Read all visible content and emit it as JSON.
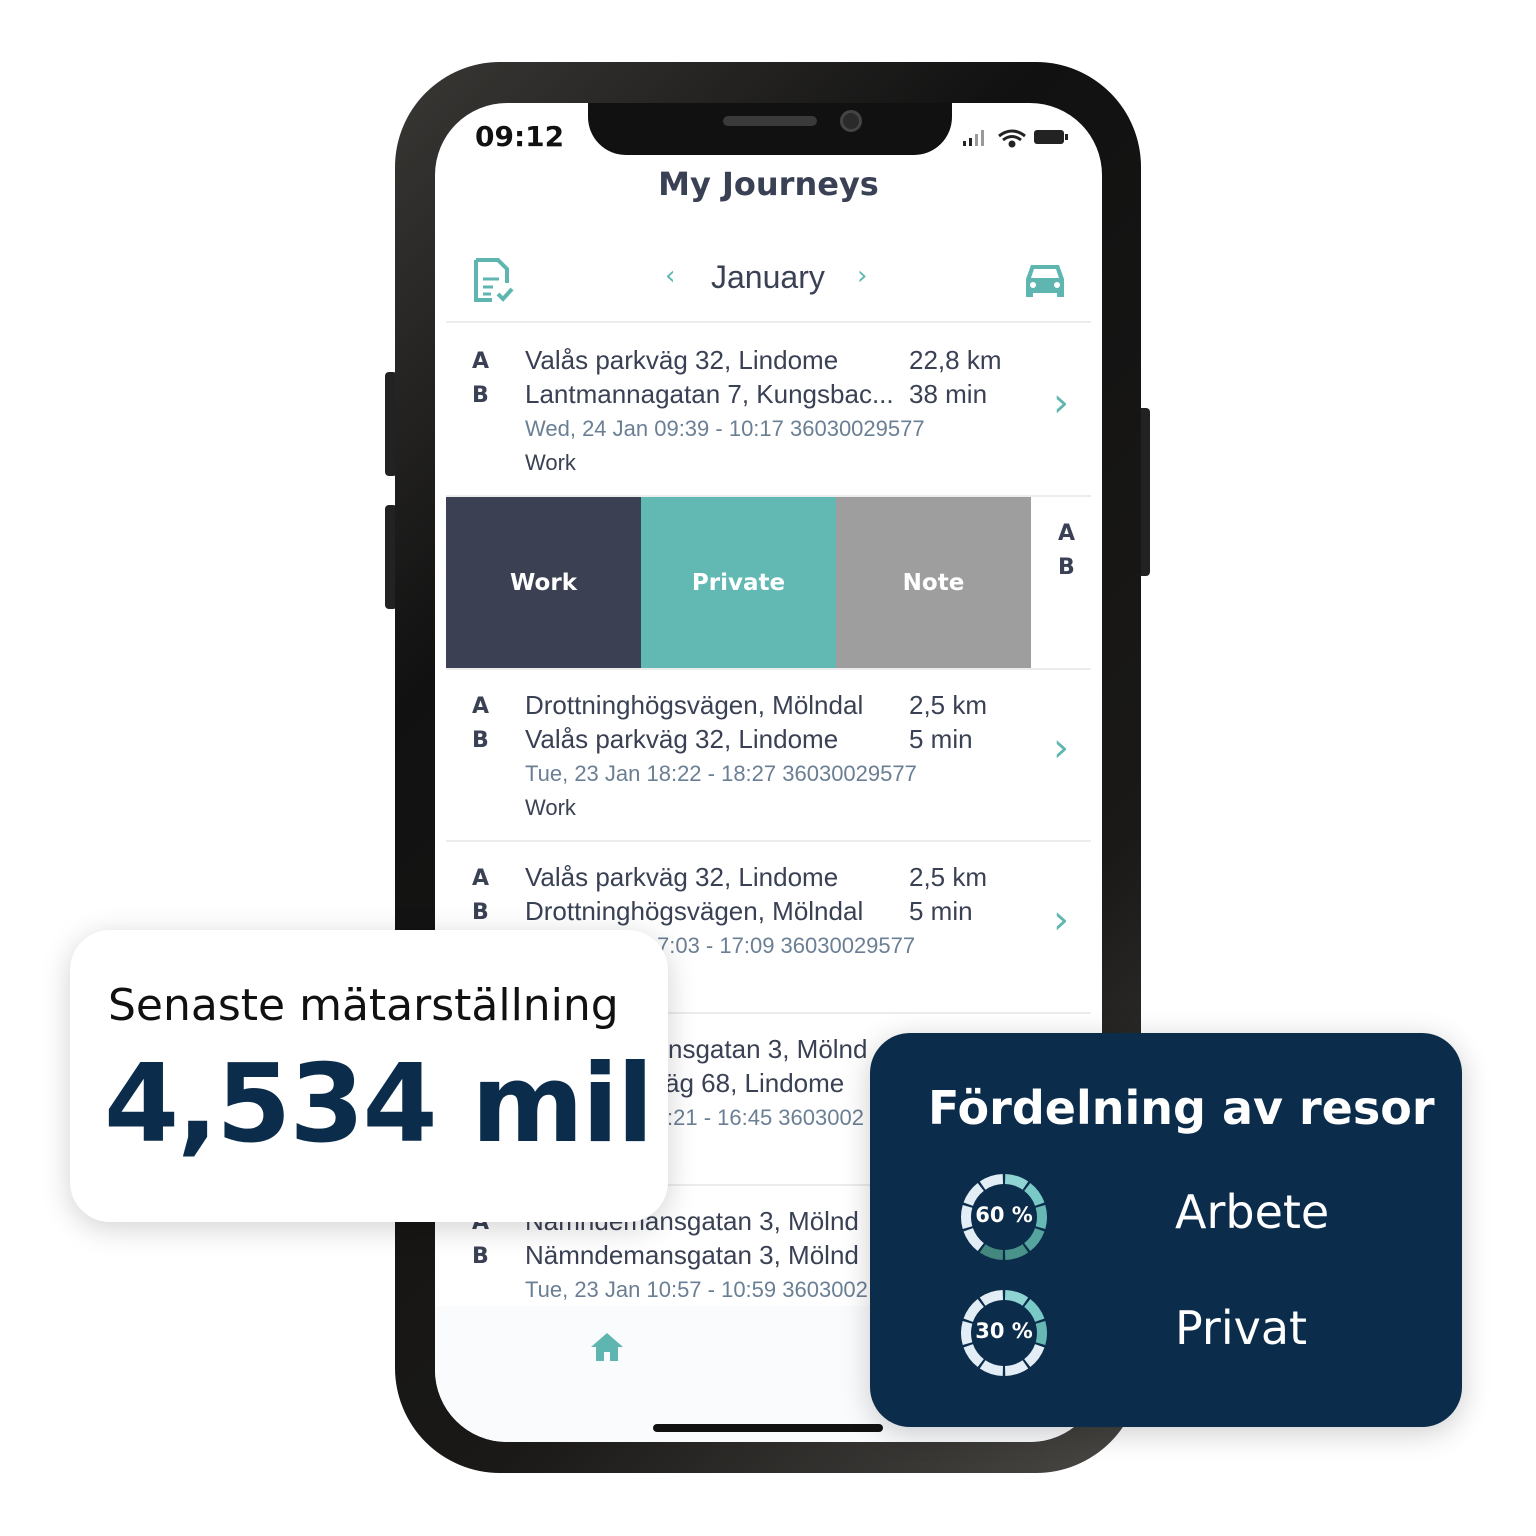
{
  "status_bar": {
    "time": "09:12"
  },
  "header": {
    "title": "My Journeys",
    "month": "January"
  },
  "journeys": [
    {
      "a_label": "A",
      "b_label": "B",
      "from": "Valås parkväg 32, Lindome",
      "to": "Lantmannagatan 7, Kungsbac...",
      "distance": "22,8 km",
      "duration": "38 min",
      "meta": "Wed, 24 Jan 09:39 - 10:17  36030029577",
      "category": "Work"
    },
    {
      "a_label": "A",
      "b_label": "B",
      "from": "Drottninghögsvägen, Mölndal",
      "to": "Valås parkväg 32, Lindome",
      "distance": "2,5 km",
      "duration": "5 min",
      "meta": "Tue, 23 Jan 18:22 - 18:27  36030029577",
      "category": "Work"
    },
    {
      "a_label": "A",
      "b_label": "B",
      "from": "Valås parkväg 32, Lindome",
      "to": "Drottninghögsvägen, Mölndal",
      "distance": "2,5 km",
      "duration": "5 min",
      "meta_partial": "7:03 - 17:09  36030029577"
    },
    {
      "from_partial": "nsgatan 3, Mölnd",
      "to_partial": "äg 68, Lindome",
      "meta_partial": ":21 - 16:45  3603002"
    },
    {
      "a_label": "A",
      "b_label": "B",
      "from_partial": "Nämndemansgatan 3, Mölnd",
      "to_partial": "Nämndemansgatan 3, Mölnd",
      "meta_partial": "Tue, 23 Jan 10:57 - 10:59  3603002"
    }
  ],
  "swipe_actions": {
    "work": "Work",
    "private": "Private",
    "note": "Note",
    "a_label": "A",
    "b_label": "B",
    "colors": {
      "work": "#3b4152",
      "private": "#62b8b2",
      "note": "#9e9e9e"
    }
  },
  "odometer_card": {
    "title": "Senaste mätarställning",
    "value": "4,534 mil"
  },
  "distribution_card": {
    "title": "Fördelning av resor",
    "items": [
      {
        "percent_label": "60 %",
        "percent": 60,
        "label": "Arbete"
      },
      {
        "percent_label": "30 %",
        "percent": 30,
        "label": "Privat"
      }
    ]
  },
  "colors": {
    "accent": "#5fb6b0",
    "navy": "#0b2d4b",
    "text": "#3a4154"
  }
}
